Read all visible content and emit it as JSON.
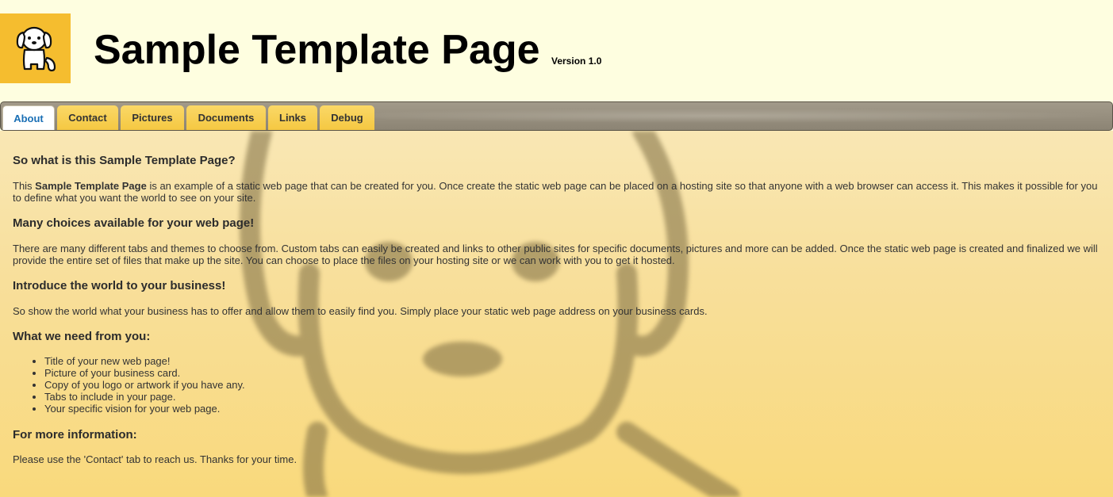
{
  "header": {
    "title": "Sample Template Page",
    "version": "Version 1.0",
    "logo_icon": "dog-icon"
  },
  "tabs": [
    {
      "label": "About",
      "active": true
    },
    {
      "label": "Contact",
      "active": false
    },
    {
      "label": "Pictures",
      "active": false
    },
    {
      "label": "Documents",
      "active": false
    },
    {
      "label": "Links",
      "active": false
    },
    {
      "label": "Debug",
      "active": false
    }
  ],
  "content": {
    "h1": "So what is this Sample Template Page?",
    "p1_pre": "This ",
    "p1_bold": "Sample Template Page",
    "p1_post": " is an example of a static web page that can be created for you. Once create the static web page can be placed on a hosting site so that anyone with a web browser can access it. This makes it possible for you to define what you want the world to see on your site.",
    "h2": "Many choices available for your web page!",
    "p2": "There are many different tabs and themes to choose from. Custom tabs can easily be created and links to other public sites for specific documents, pictures and more can be added. Once the static web page is created and finalized we will provide the entire set of files that make up the site. You can choose to place the files on your hosting site or we can work with you to get it hosted.",
    "h3": "Introduce the world to your business!",
    "p3": "So show the world what your business has to offer and allow them to easily find you. Simply place your static web page address on your business cards.",
    "h4": "What we need from you:",
    "needs": [
      "Title of your new web page!",
      "Picture of your business card.",
      "Copy of you logo or artwork if you have any.",
      "Tabs to include in your page.",
      "Your specific vision for your web page."
    ],
    "h5": "For more information:",
    "p5": "Please use the 'Contact' tab to reach us. Thanks for your time."
  },
  "colors": {
    "logo_bg": "#f5bd2f",
    "header_bg": "#fefee0",
    "tab_bg": "#f5c842",
    "active_tab_text": "#1a6fb5"
  }
}
